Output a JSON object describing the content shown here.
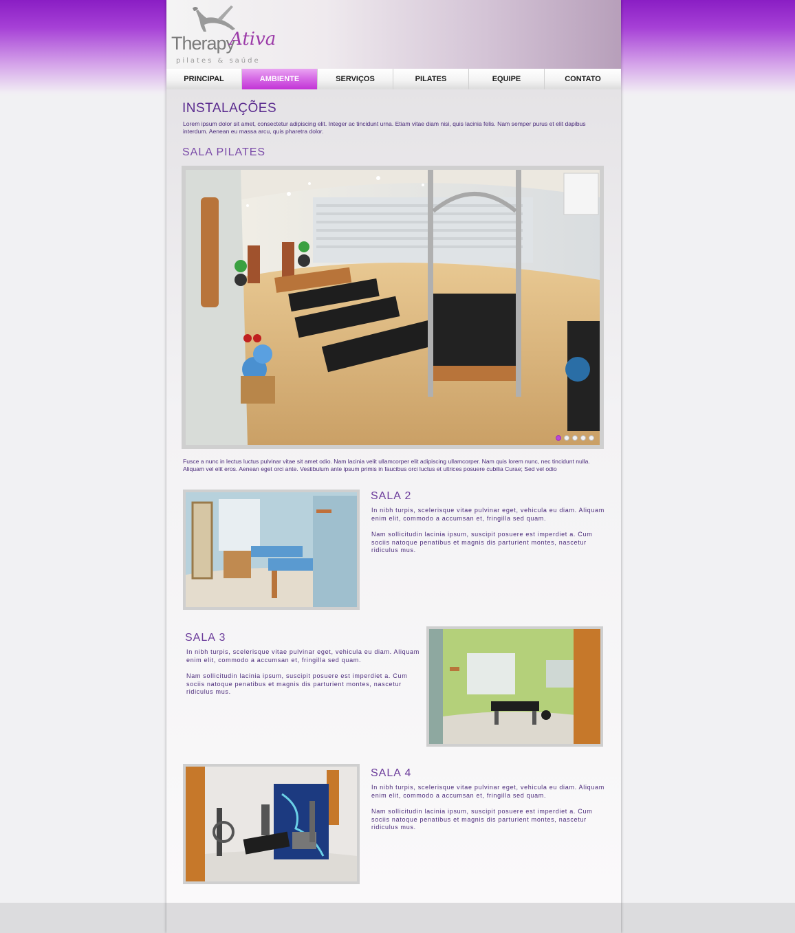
{
  "brand": {
    "name_part1": "Therapy",
    "name_part2": "Ativa",
    "tagline": "pilates & saúde"
  },
  "nav": {
    "items": [
      "PRINCIPAL",
      "AMBIENTE",
      "SERVIÇOS",
      "PILATES",
      "EQUIPE",
      "CONTATO"
    ],
    "active_index": 1
  },
  "main": {
    "title": "INSTALAÇÕES",
    "intro": "Lorem ipsum dolor sit amet, consectetur adipiscing elit. Integer ac tincidunt urna. Etiam vitae diam nisi, quis lacinia felis. Nam semper purus et elit dapibus interdum. Aenean eu massa arcu, quis pharetra dolor.",
    "featured": {
      "title": "SALA PILATES",
      "slider_dots": 5,
      "active_dot": 0,
      "caption": "Fusce a nunc in lectus luctus pulvinar vitae sit amet odio. Nam lacinia velit ullamcorper elit adipiscing ullamcorper. Nam quis lorem nunc, nec tincidunt nulla. Aliquam vel elit eros. Aenean eget orci ante. Vestibulum ante ipsum primis in faucibus orci luctus et ultrices posuere cubilia Curae; Sed vel odio"
    },
    "rooms": [
      {
        "title": "SALA 2",
        "p1": "In nibh turpis, scelerisque vitae pulvinar eget, vehicula eu diam. Aliquam enim elit, commodo a accumsan et, fringilla sed quam.",
        "p2": "Nam sollicitudin lacinia ipsum, suscipit posuere est imperdiet a. Cum sociis natoque penatibus et magnis dis parturient montes, nascetur ridiculus mus."
      },
      {
        "title": "SALA 3",
        "p1": "In nibh turpis, scelerisque vitae pulvinar eget, vehicula eu diam. Aliquam enim elit, commodo a accumsan et, fringilla sed quam.",
        "p2": "Nam sollicitudin lacinia ipsum, suscipit posuere est imperdiet a. Cum sociis natoque penatibus et magnis dis parturient montes, nascetur ridiculus mus."
      },
      {
        "title": "SALA 4",
        "p1": "In nibh turpis, scelerisque vitae pulvinar eget, vehicula eu diam. Aliquam enim elit, commodo a accumsan et, fringilla sed quam.",
        "p2": "Nam sollicitudin lacinia ipsum, suscipit posuere est imperdiet a. Cum sociis natoque penatibus et magnis dis parturient montes, nascetur ridiculus mus."
      }
    ]
  },
  "colors": {
    "brand_purple": "#8a1ec4",
    "nav_active": "#c233d6",
    "heading": "#5a2a8e",
    "text": "#4a2a7a"
  }
}
